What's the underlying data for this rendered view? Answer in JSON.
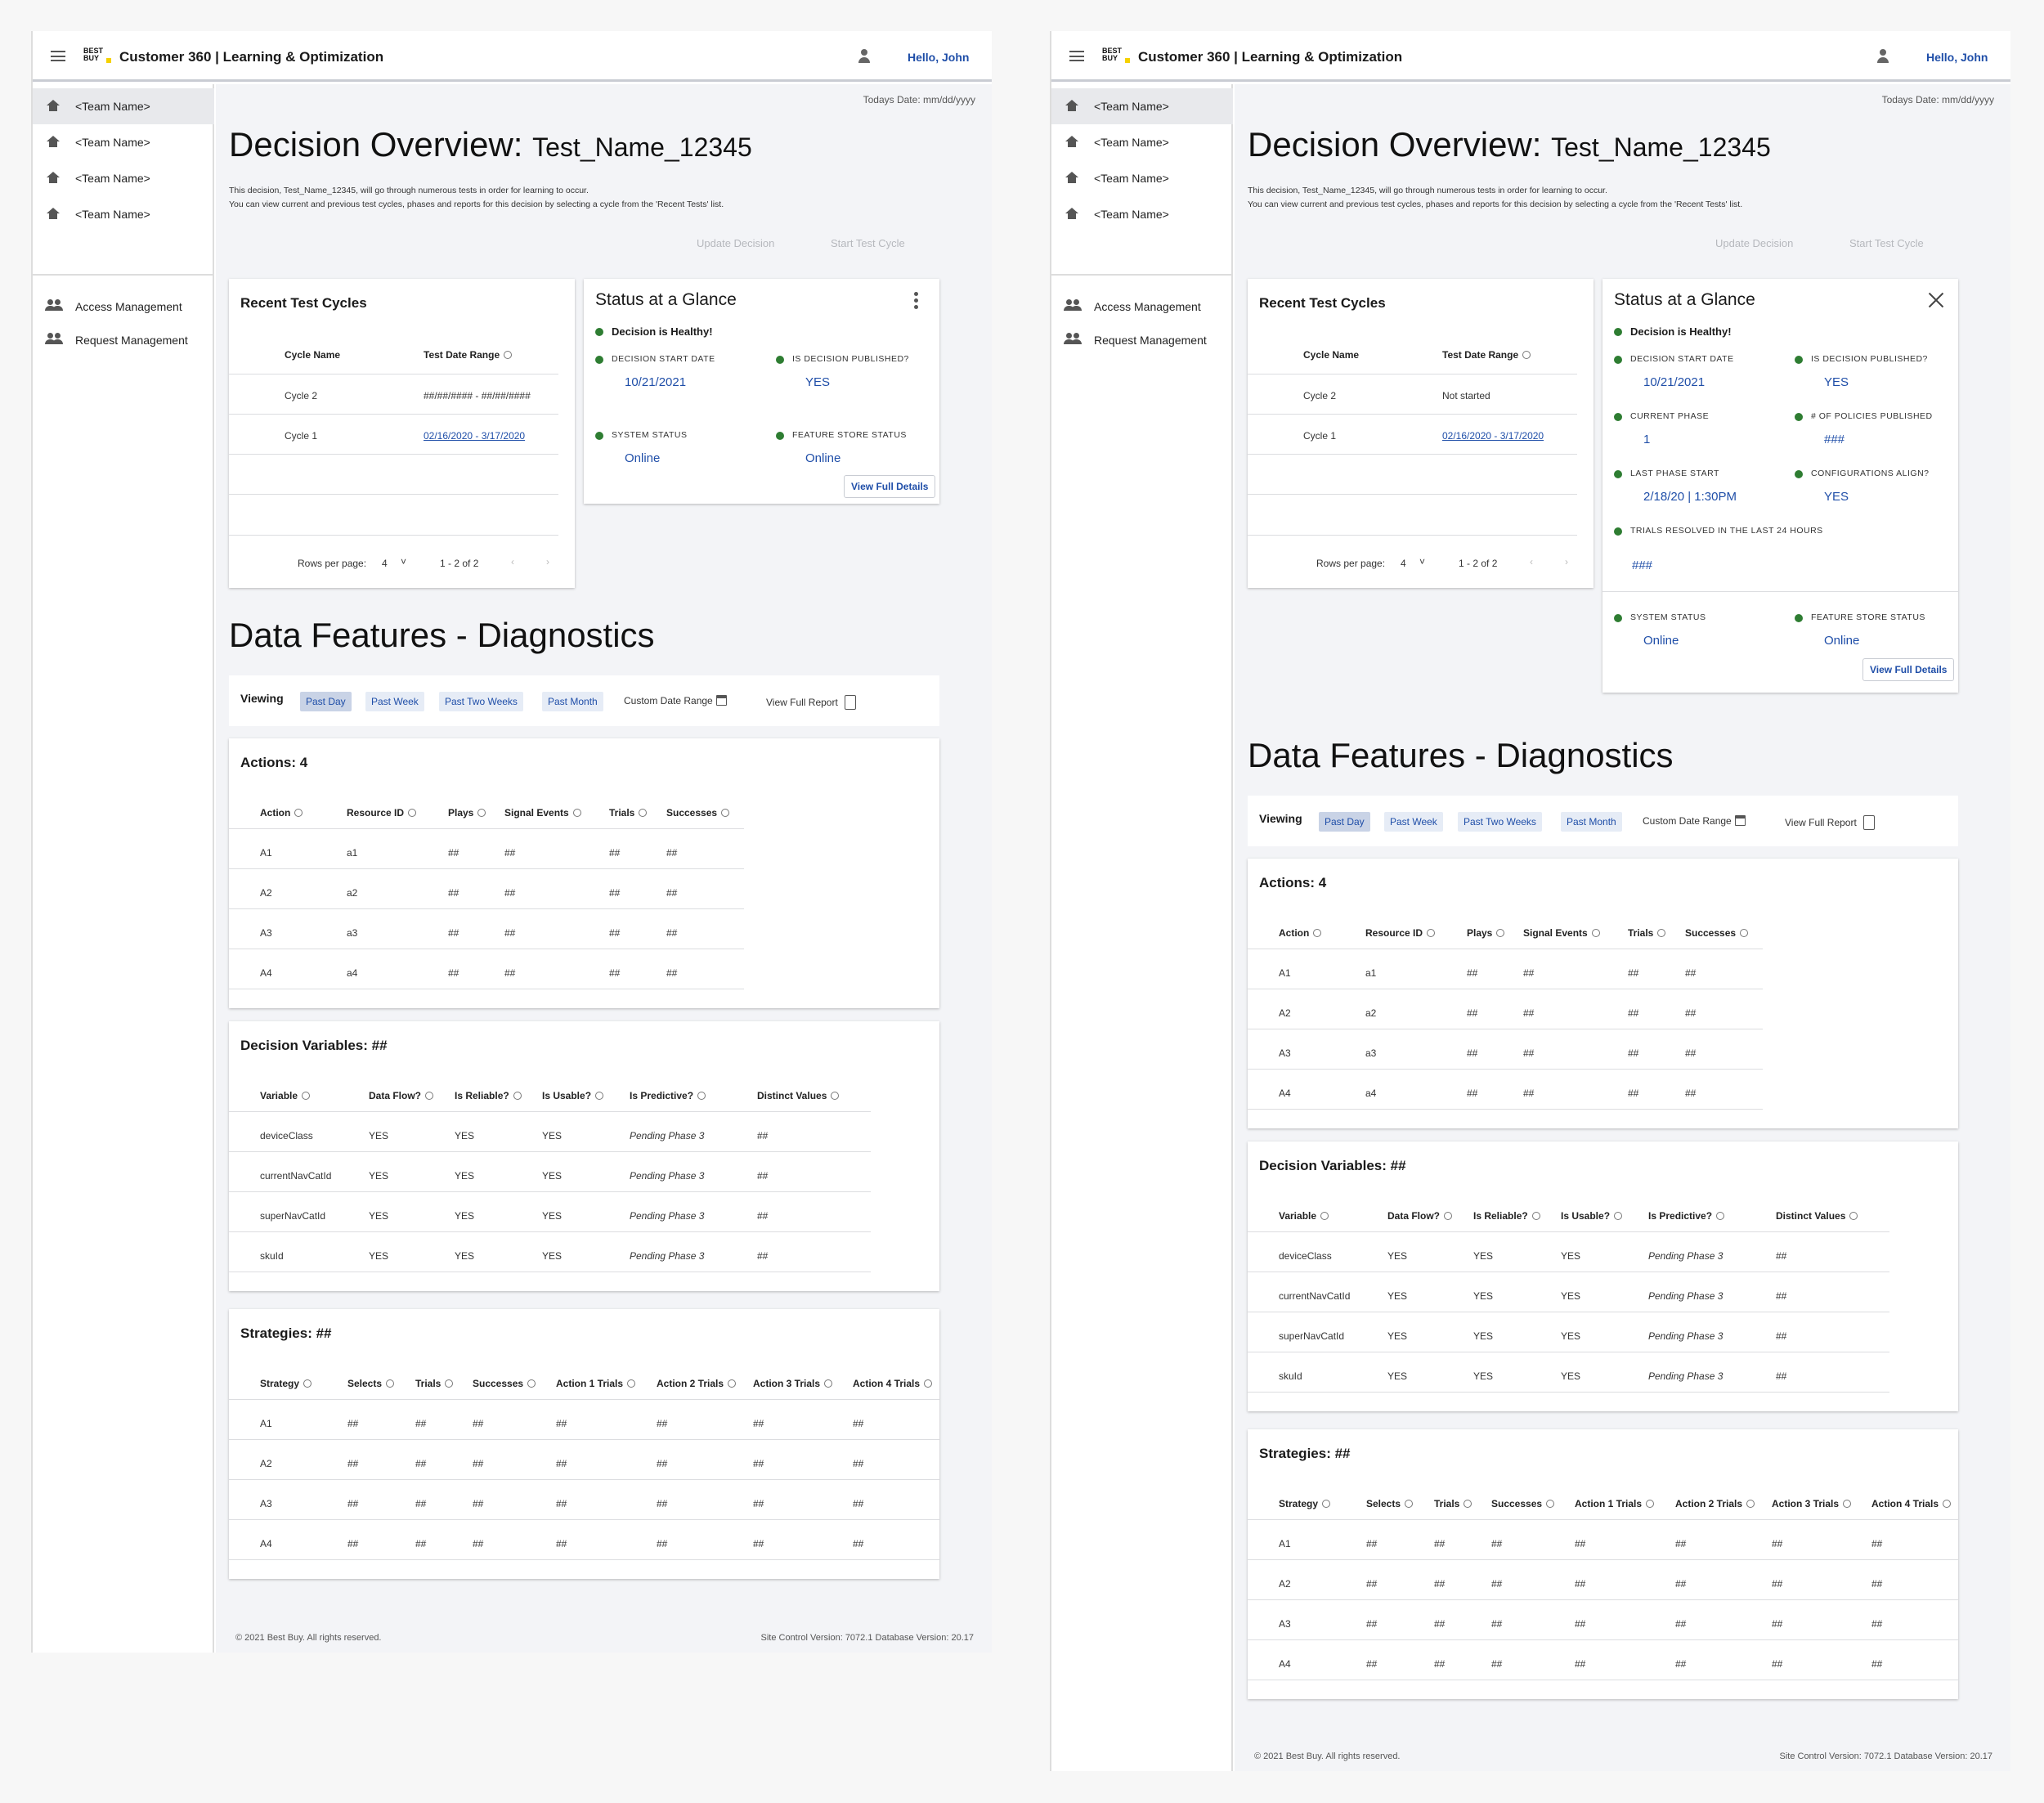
{
  "app": {
    "title": "Customer 360 | Learning & Optimization",
    "logo": "BEST BUY",
    "greeting": "Hello, John"
  },
  "sidebar": {
    "teams": [
      "<Team Name>",
      "<Team Name>",
      "<Team Name>",
      "<Team Name>"
    ],
    "admin": [
      "Access Management",
      "Request Management"
    ]
  },
  "page": {
    "todays_date": "Todays Date:  mm/dd/yyyy",
    "title": "Decision Overview:",
    "title_name": "Test_Name_12345",
    "desc1": "This decision, Test_Name_12345, will go through numerous tests in order for learning to occur.",
    "desc2": "You can view current and previous test cycles, phases and reports for this decision by selecting a cycle from the 'Recent Tests' list.",
    "update_btn": "Update Decision",
    "start_btn": "Start Test Cycle"
  },
  "recent": {
    "title": "Recent Test Cycles",
    "col_cycle": "Cycle Name",
    "col_range": "Test Date Range",
    "left_rows": [
      {
        "name": "Cycle 2",
        "range": "##/##/#### - ##/##/####"
      },
      {
        "name": "Cycle 1",
        "range": "02/16/2020 - 3/17/2020"
      }
    ],
    "right_rows": [
      {
        "name": "Cycle 2",
        "range": "Not started"
      },
      {
        "name": "Cycle 1",
        "range": "02/16/2020 - 3/17/2020"
      }
    ],
    "rows_per_page": "Rows per page:",
    "rows_value": "4",
    "dropdown": "˅",
    "range_label": "1 - 2 of 2",
    "prev": "‹",
    "next": "›"
  },
  "glance": {
    "title": "Status at a Glance",
    "healthy": "Decision is Healthy!",
    "start_label": "Decision Start Date",
    "start_value": "10/21/2021",
    "published_label": "Is Decision Published?",
    "published_value": "YES",
    "phase_label": "Current Phase",
    "phase_value": "1",
    "policies_label": "# of Policies Published",
    "policies_value": "###",
    "last_phase_label": "Last Phase Start",
    "last_phase_value": "2/18/20 | 1:30PM",
    "config_label": "Configurations Align?",
    "config_value": "YES",
    "trials_label": "Trials Resolved in the Last 24 Hours",
    "trials_value": "###",
    "system_label": "System Status",
    "system_value": "Online",
    "feature_label": "Feature Store Status",
    "feature_value": "Online",
    "details_btn": "View Full Details"
  },
  "diagnostics": {
    "title": "Data Features - Diagnostics",
    "viewing": "Viewing",
    "chips": [
      "Past Day",
      "Past Week",
      "Past Two Weeks",
      "Past Month"
    ],
    "selected": "Past Day",
    "custom": "Custom Date Range",
    "report": "View Full Report"
  },
  "actions": {
    "title": "Actions: 4",
    "headers": [
      "Action",
      "Resource ID",
      "Plays",
      "Signal Events",
      "Trials",
      "Successes"
    ],
    "rows": [
      [
        "A1",
        "a1",
        "##",
        "##",
        "##",
        "##"
      ],
      [
        "A2",
        "a2",
        "##",
        "##",
        "##",
        "##"
      ],
      [
        "A3",
        "a3",
        "##",
        "##",
        "##",
        "##"
      ],
      [
        "A4",
        "a4",
        "##",
        "##",
        "##",
        "##"
      ]
    ]
  },
  "variables": {
    "title": "Decision Variables: ##",
    "headers": [
      "Variable",
      "Data Flow?",
      "Is Reliable?",
      "Is Usable?",
      "Is Predictive?",
      "Distinct Values"
    ],
    "rows": [
      [
        "deviceClass",
        "YES",
        "YES",
        "YES",
        "Pending Phase 3",
        "##"
      ],
      [
        "currentNavCatId",
        "YES",
        "YES",
        "YES",
        "Pending Phase 3",
        "##"
      ],
      [
        "superNavCatId",
        "YES",
        "YES",
        "YES",
        "Pending Phase 3",
        "##"
      ],
      [
        "skuId",
        "YES",
        "YES",
        "YES",
        "Pending Phase 3",
        "##"
      ]
    ]
  },
  "strategies": {
    "title": "Strategies: ##",
    "headers": [
      "Strategy",
      "Selects",
      "Trials",
      "Successes",
      "Action 1 Trials",
      "Action 2 Trials",
      "Action 3 Trials",
      "Action 4 Trials"
    ],
    "rows": [
      [
        "A1",
        "##",
        "##",
        "##",
        "##",
        "##",
        "##",
        "##"
      ],
      [
        "A2",
        "##",
        "##",
        "##",
        "##",
        "##",
        "##",
        "##"
      ],
      [
        "A3",
        "##",
        "##",
        "##",
        "##",
        "##",
        "##",
        "##"
      ],
      [
        "A4",
        "##",
        "##",
        "##",
        "##",
        "##",
        "##",
        "##"
      ]
    ]
  },
  "footer": {
    "copyright": "© 2021 Best Buy. All rights reserved.",
    "version": "Site Control Version: 7072.1  Database Version: 20.17"
  }
}
